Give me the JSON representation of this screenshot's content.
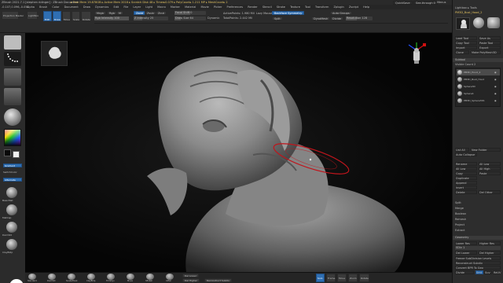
{
  "window": {
    "title": "ZBrush 2021.7.1 [stephen ridinger] : ZBrush Document",
    "stats": "▸ Free Mem 19.878GB ▸ Active Mem 2018 ▸ Scratch Disk 48 ▸ Timer▸0.079 ▸ PolyCount▸ 1.211 MP ▸ MeshCount▸ 2",
    "quicksave": "QuickSave",
    "see_through": "See-through 0",
    "menus_label": "Menus",
    "default_script": "DefaultZScript"
  },
  "menubar": {
    "coords": "-0.107,0.096,-0.051",
    "items": [
      "Alpha",
      "Brush",
      "Color",
      "Document",
      "Draw",
      "Dynamics",
      "Edit",
      "File",
      "Layer",
      "Light",
      "Macro",
      "Marker",
      "Material",
      "Movie",
      "Picker",
      "Preferences",
      "Render",
      "Stencil",
      "Stroke",
      "Texture",
      "Tool",
      "Transform",
      "Zplugin",
      "Zscript",
      "Help"
    ]
  },
  "topshelf": {
    "projection_master": "Projection Master",
    "lightbox": "LightBox",
    "buttons": [
      "Edit",
      "Draw",
      "Move",
      "Scale",
      "Rotate"
    ],
    "mrgb": "Mrgb",
    "rgb": "Rgb",
    "m": "M",
    "zadd": "Zadd",
    "zsub": "Zsub",
    "zcut": "Zcut",
    "rgb_intensity": "Rgb Intensity 100",
    "z_intensity": "Z Intensity 25",
    "focal_shift": "Focal Shift 0",
    "draw_size": "Draw Size 64",
    "dynamic": "Dynamic",
    "active_points": "ActivePoints: 1.980 Mil",
    "total_points": "TotalPoints: 2.442 Mil",
    "lazy_mouse": "Lazy Mouse",
    "backface": "Backface Symmetry",
    "auto_groups": "Auto Groups",
    "split": "Split",
    "dynamesh": "DynaMesh",
    "divide": "Divide",
    "resolution": "Resolution 128",
    "subdiv_slider": "SubDiv"
  },
  "leftshelf": {
    "alpha_off": "Alpha Off",
    "texture_off": "Texture Off",
    "material": "SkinShade4",
    "gradient": "Gradient",
    "switch_color": "SwitchColor",
    "alternate": "Alternate",
    "brush_names": [
      "BasicMat",
      "MatCap",
      "DamStd",
      "ClayBldp",
      "BasicMat02"
    ]
  },
  "bottombar": {
    "brushes": [
      "Standard",
      "DamStd",
      "SnakeHook",
      "ClayBldp",
      "TrimDyn",
      "Move",
      "hPolish",
      "Inflat",
      "Pinch",
      "ZModel"
    ],
    "sdiv_label": "SDiv",
    "del_lower": "Del Lower",
    "del_higher": "Del Higher",
    "reconstruct": "Reconstruct Subdiv",
    "smooth": "Smt",
    "solo": "Solo",
    "frame": "Frame",
    "move": "Move",
    "zoom": "Zoom",
    "rotate": "Rotate"
  },
  "rightpanel": {
    "lightbox_tools": "Lightbox ▸ Tools",
    "tool_name": "PM3D_Bust_Hood_2",
    "load_tool": "Load Tool",
    "save_as": "Save As",
    "copy_tool": "Copy Tool",
    "paste_tool": "Paste Tool",
    "import": "Import",
    "export": "Export",
    "clone": "Clone",
    "make_polymesh": "Make PolyMesh3D",
    "goz": "GoZ",
    "all": "All",
    "visible": "Visible",
    "r": "R",
    "subtool_header": "Subtool",
    "visible_count": "Visible Count 2",
    "subtools": [
      "PM3D_Hood_2",
      "PM3D_Bust_Hood",
      "Sphere3D",
      "Sphere4",
      "PM3D_Sphere3D1"
    ],
    "list_all": "List All",
    "new_folder": "New Folder",
    "auto_collapse": "Auto Collapse",
    "rename": "Rename",
    "all_low": "All Low",
    "all_high": "All High",
    "copy": "Copy",
    "paste": "Paste",
    "duplicate": "Duplicate",
    "append": "Append",
    "insert": "Insert",
    "delete": "Delete",
    "del_other": "Del Other",
    "del_all": "Del All",
    "split": "Split",
    "merge": "Merge",
    "boolean": "Boolean",
    "remesh": "Remesh",
    "project": "Project",
    "extract": "Extract",
    "geometry": "Geometry",
    "lower_res": "Lower Res",
    "higher_res": "Higher Res",
    "sdiv": "SDiv 1",
    "del_lower": "Del Lower",
    "del_higher": "Del Higher",
    "freeze": "Freeze SubDivision Levels",
    "reconstruct": "Reconstruct Subdiv",
    "convert_bpr": "Convert BPR To Geo",
    "divide": "Divide",
    "smt": "Smt",
    "suv": "Suv",
    "reuv": "ReUV"
  },
  "colors": {
    "accent_blue": "#2f6fb3",
    "stroke_red": "#c0151c",
    "logo_red": "#e0301e"
  }
}
